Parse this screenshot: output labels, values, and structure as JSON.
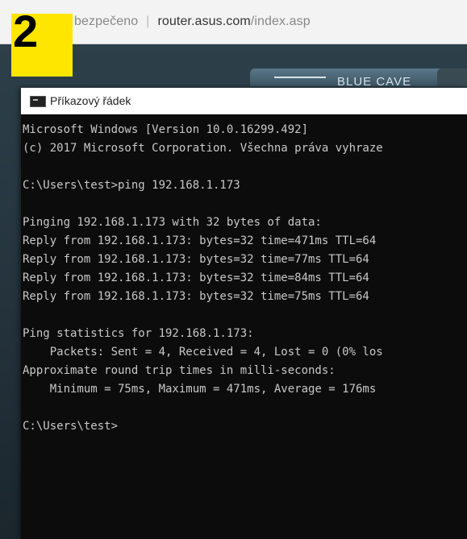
{
  "browser": {
    "security_label": "bezpečeno",
    "url_host": "router.asus.com",
    "url_path": "/index.asp"
  },
  "step": {
    "number": "2",
    "color": "#ffe600"
  },
  "router_page": {
    "tab_label": "BLUE CAVE"
  },
  "console": {
    "title": "Příkazový řádek",
    "icon": "cmd-icon",
    "lines": [
      "Microsoft Windows [Version 10.0.16299.492]",
      "(c) 2017 Microsoft Corporation. Všechna práva vyhraze",
      "",
      "C:\\Users\\test>ping 192.168.1.173",
      "",
      "Pinging 192.168.1.173 with 32 bytes of data:",
      "Reply from 192.168.1.173: bytes=32 time=471ms TTL=64",
      "Reply from 192.168.1.173: bytes=32 time=77ms TTL=64",
      "Reply from 192.168.1.173: bytes=32 time=84ms TTL=64",
      "Reply from 192.168.1.173: bytes=32 time=75ms TTL=64",
      "",
      "Ping statistics for 192.168.1.173:",
      "    Packets: Sent = 4, Received = 4, Lost = 0 (0% los",
      "Approximate round trip times in milli-seconds:",
      "    Minimum = 75ms, Maximum = 471ms, Average = 176ms",
      "",
      "C:\\Users\\test>"
    ]
  }
}
